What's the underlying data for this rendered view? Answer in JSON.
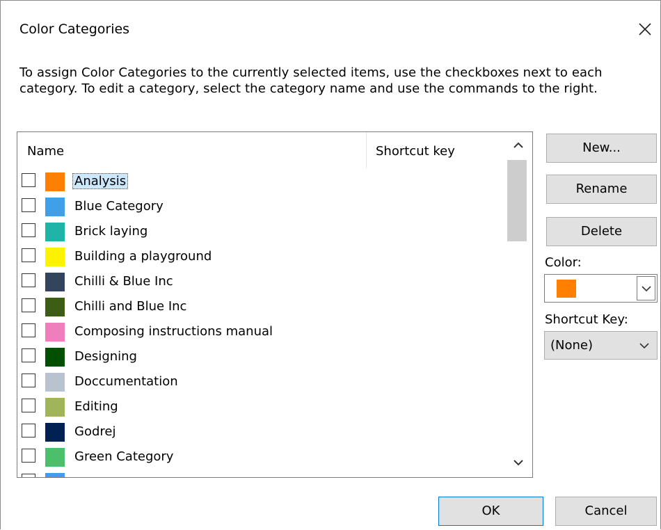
{
  "dialog": {
    "title": "Color Categories",
    "instructions": "To assign Color Categories to the currently selected items, use the checkboxes next to each category.  To edit a category, select the category name and use the commands to the right."
  },
  "list": {
    "columns": [
      "Name",
      "Shortcut key"
    ],
    "categories": [
      {
        "name": "Analysis",
        "color": "#ff8000",
        "selected": true
      },
      {
        "name": "Blue Category",
        "color": "#3fa0e8"
      },
      {
        "name": "Brick laying",
        "color": "#1fb5a6"
      },
      {
        "name": "Building a playground",
        "color": "#fff200"
      },
      {
        "name": "Chilli & Blue Inc",
        "color": "#35445d"
      },
      {
        "name": "Chilli and Blue Inc",
        "color": "#3d5c14"
      },
      {
        "name": "Composing instructions manual",
        "color": "#ef7fba"
      },
      {
        "name": "Designing",
        "color": "#005000"
      },
      {
        "name": "Doccumentation",
        "color": "#b8c3cf"
      },
      {
        "name": "Editing",
        "color": "#a0b45a"
      },
      {
        "name": "Godrej",
        "color": "#002154"
      },
      {
        "name": "Green Category",
        "color": "#4bbf6a"
      },
      {
        "name": "",
        "color": "#3fa0e8"
      }
    ]
  },
  "buttons": {
    "new": "New...",
    "rename": "Rename",
    "delete": "Delete",
    "ok": "OK",
    "cancel": "Cancel"
  },
  "color_picker": {
    "label": "Color:",
    "value_color": "#ff8000"
  },
  "shortcut_key": {
    "label": "Shortcut Key:",
    "value": "(None)"
  },
  "icons": {
    "close": "close-icon",
    "scroll_up": "chevron-up-icon",
    "scroll_down": "chevron-down-icon",
    "dropdown": "chevron-down-icon"
  }
}
